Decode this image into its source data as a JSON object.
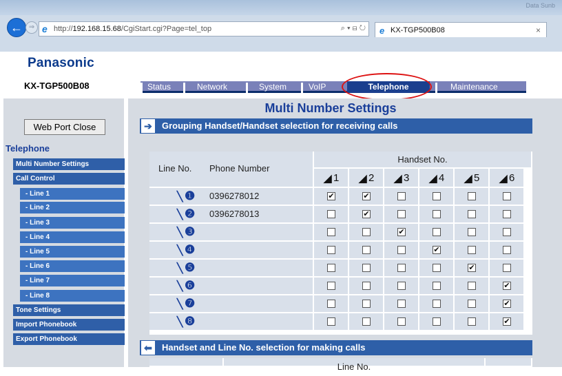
{
  "browser": {
    "window_label": "Data Sunb",
    "url_prefix": "http://",
    "url_host": "192.168.15.68",
    "url_path": "/CgiStart.cgi?Page=tel_top",
    "address_controls": "⌕ ▾ ⊟ ↻",
    "tab_title": "KX-TGP500B08",
    "tab_close": "×",
    "back_glyph": "←",
    "forward_glyph": "⇒"
  },
  "header": {
    "logo": "Panasonic",
    "model": "KX-TGP500B08"
  },
  "nav": {
    "tabs": [
      "Status",
      "Network",
      "System",
      "VoIP",
      "Telephone",
      "Maintenance"
    ],
    "active": "Telephone"
  },
  "sidebar": {
    "web_port_button": "Web Port Close",
    "heading": "Telephone",
    "items": [
      "Multi Number Settings",
      "Call Control",
      "- Line 1",
      "- Line 2",
      "- Line 3",
      "- Line 4",
      "- Line 5",
      "- Line 6",
      "- Line 7",
      "- Line 8",
      "Tone Settings",
      "Import Phonebook",
      "Export Phonebook"
    ]
  },
  "main": {
    "title": "Multi Number Settings",
    "section1": {
      "title": "Grouping Handset/Handset selection for receiving calls",
      "col_line_no": "Line No.",
      "col_phone_number": "Phone Number",
      "col_handset_no": "Handset No.",
      "handsets": [
        "1",
        "2",
        "3",
        "4",
        "5",
        "6"
      ],
      "rows": [
        {
          "line": "❶",
          "phone": "0396278012",
          "checks": [
            true,
            true,
            false,
            false,
            false,
            false
          ]
        },
        {
          "line": "❷",
          "phone": "0396278013",
          "checks": [
            false,
            true,
            false,
            false,
            false,
            false
          ]
        },
        {
          "line": "❸",
          "phone": "",
          "checks": [
            false,
            false,
            true,
            false,
            false,
            false
          ]
        },
        {
          "line": "❹",
          "phone": "",
          "checks": [
            false,
            false,
            false,
            true,
            false,
            false
          ]
        },
        {
          "line": "❺",
          "phone": "",
          "checks": [
            false,
            false,
            false,
            false,
            true,
            false
          ]
        },
        {
          "line": "❻",
          "phone": "",
          "checks": [
            false,
            false,
            false,
            false,
            false,
            true
          ]
        },
        {
          "line": "❼",
          "phone": "",
          "checks": [
            false,
            false,
            false,
            false,
            false,
            true
          ]
        },
        {
          "line": "❽",
          "phone": "",
          "checks": [
            false,
            false,
            false,
            false,
            false,
            true
          ]
        }
      ]
    },
    "section2": {
      "title": "Handset and Line No. selection for making calls",
      "col_line_no": "Line No."
    }
  },
  "colors": {
    "brand": "#0b3a8c",
    "nav_bg": "#7a81b9",
    "nav_active": "#1b3f8e",
    "section_bar": "#2e5fa8",
    "highlight": "#dd1111"
  }
}
